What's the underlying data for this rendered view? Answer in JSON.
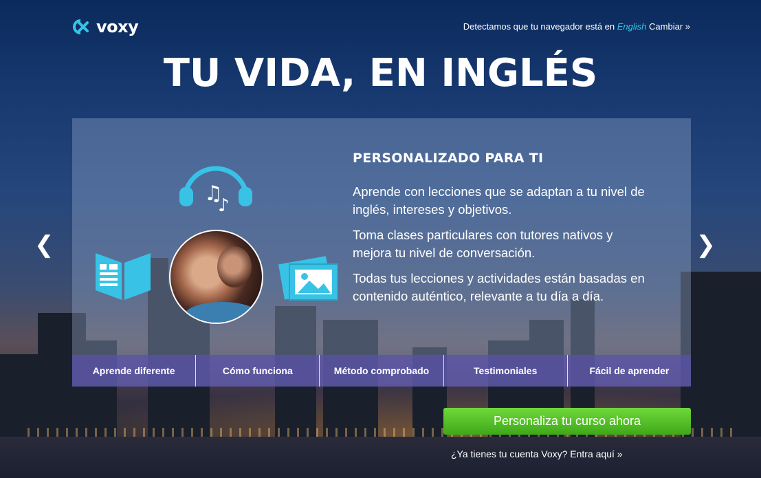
{
  "header": {
    "logo_text": "voxy",
    "language_note": "Detectamos que tu navegador está en",
    "language_name": "English",
    "change_link": "Cambiar »"
  },
  "hero": {
    "headline": "TU VIDA, EN INGLÉS"
  },
  "slide": {
    "title": "PERSONALIZADO PARA TI",
    "paragraphs": [
      "Aprende con lecciones que se adaptan a tu nivel de inglés, intereses y objetivos.",
      "Toma clases particulares con tutores nativos y mejora tu nivel de conversación.",
      "Todas tus lecciones y actividades están basadas en contenido auténtico, relevante a tu día a día."
    ],
    "prev_arrow": "❮",
    "next_arrow": "❯"
  },
  "tabs": [
    {
      "label": "Aprende diferente"
    },
    {
      "label": "Cómo funciona"
    },
    {
      "label": "Método comprobado"
    },
    {
      "label": "Testimoniales"
    },
    {
      "label": "Fácil de aprender"
    }
  ],
  "cta": {
    "label": "Personaliza tu curso ahora"
  },
  "login": {
    "text": "¿Ya tienes tu cuenta Voxy? Entra aquí »"
  },
  "colors": {
    "accent": "#38c3e6",
    "cta_green": "#4fba22",
    "tab_bar": "#5a50aa"
  },
  "icons": [
    "voxy-logo-icon",
    "headphones-icon",
    "music-note-icon",
    "book-icon",
    "photo-icon",
    "chevron-left-icon",
    "chevron-right-icon"
  ]
}
